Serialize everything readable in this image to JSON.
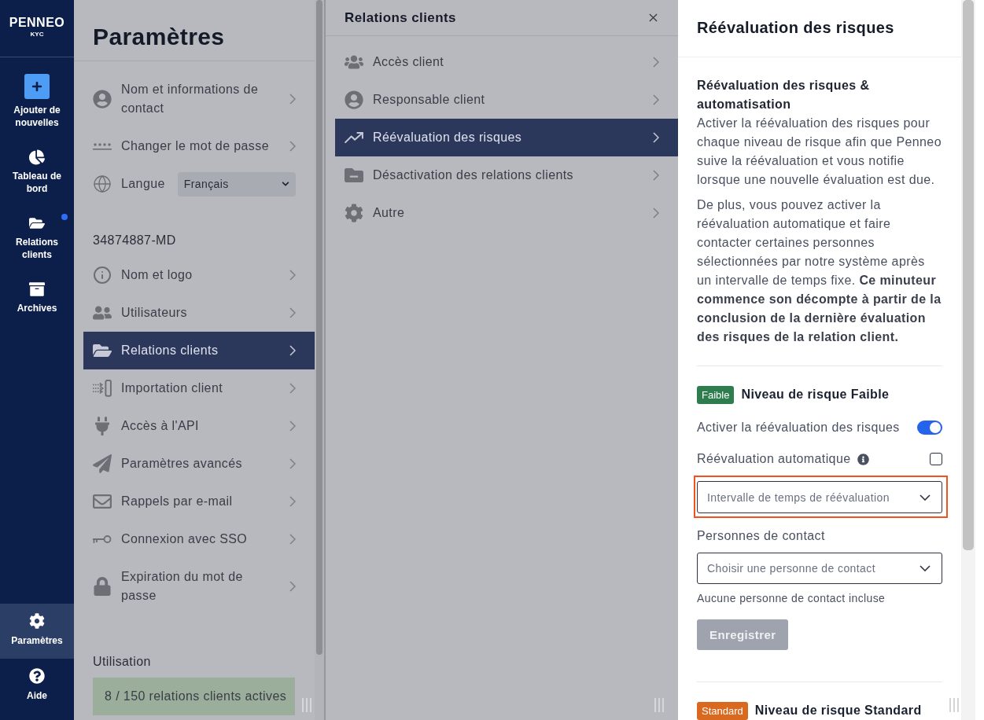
{
  "nav": {
    "logo": {
      "wordmark": "PENNEO",
      "product": "KYC"
    },
    "items": [
      {
        "kind": "action",
        "label": "Ajouter de nouvelles",
        "selected": false,
        "notification": false
      },
      {
        "kind": "link",
        "label": "Tableau de bord",
        "selected": false,
        "notification": false
      },
      {
        "kind": "link",
        "label": "Relations clients",
        "selected": false,
        "notification": true
      },
      {
        "kind": "link",
        "label": "Archives",
        "selected": false,
        "notification": false
      }
    ],
    "bottom_items": [
      {
        "label": "Paramètres",
        "selected": true
      },
      {
        "label": "Aide",
        "selected": false
      }
    ]
  },
  "settings": {
    "title": "Paramètres",
    "account_items": [
      {
        "kind": "link",
        "label": "Nom et informations de contact",
        "selected": false
      },
      {
        "kind": "link",
        "label": "Changer le mot de passe",
        "selected": false
      },
      {
        "kind": "select",
        "label": "Langue",
        "value": "Français"
      }
    ],
    "company_name": "34874887-MD",
    "company_items": [
      {
        "label": "Nom et logo",
        "selected": false
      },
      {
        "label": "Utilisateurs",
        "selected": false
      },
      {
        "label": "Relations clients",
        "selected": true
      },
      {
        "label": "Importation client",
        "selected": false
      },
      {
        "label": "Accès à l'API",
        "selected": false
      },
      {
        "label": "Paramètres avancés",
        "selected": false
      },
      {
        "label": "Rappels par e-mail",
        "selected": false
      },
      {
        "label": "Connexion avec SSO",
        "selected": false
      },
      {
        "label": "Expiration du mot de passe",
        "selected": false
      }
    ],
    "usage": {
      "label": "Utilisation",
      "value": "8 / 150 relations clients actives"
    }
  },
  "relations_panel": {
    "title": "Relations clients",
    "items": [
      {
        "label": "Accès client",
        "selected": false
      },
      {
        "label": "Responsable client",
        "selected": false
      },
      {
        "label": "Réévaluation des risques",
        "selected": true
      },
      {
        "label": "Désactivation des relations clients",
        "selected": false
      },
      {
        "label": "Autre",
        "selected": false
      }
    ]
  },
  "risk_panel": {
    "title": "Réévaluation des risques",
    "intro_heading": "Réévaluation des risques & automatisation",
    "paragraphs": [
      "Activer la réévaluation des risques pour chaque niveau de risque afin que Penneo suive la réévaluation et vous notifie lorsque une nouvelle évaluation est due.",
      "De plus, vous pouvez activer la réévaluation automatique et faire contacter certaines personnes sélectionnées par notre système après un intervalle de temps fixe. **Ce minuteur commence son décompte à partir de la conclusion de la dernière évaluation des risques de la relation client.**"
    ],
    "levels": [
      {
        "badge": "Faible",
        "color": "#2e7d4f",
        "title": "Niveau de risque Faible",
        "enable": {
          "label": "Activer la réévaluation des risques",
          "on": true
        },
        "automatic": {
          "label": "Réévaluation automatique",
          "checked": false
        },
        "interval": {
          "placeholder": "Intervalle de temps de réévaluation",
          "highlighted": true
        },
        "contacts": {
          "label": "Personnes de contact",
          "placeholder": "Choisir une personne de contact",
          "hint": "Aucune personne de contact incluse"
        },
        "save": {
          "label": "Enregistrer",
          "disabled": true
        }
      },
      {
        "badge": "Standard",
        "color": "#d9691f",
        "title": "Niveau de risque Standard"
      }
    ]
  }
}
